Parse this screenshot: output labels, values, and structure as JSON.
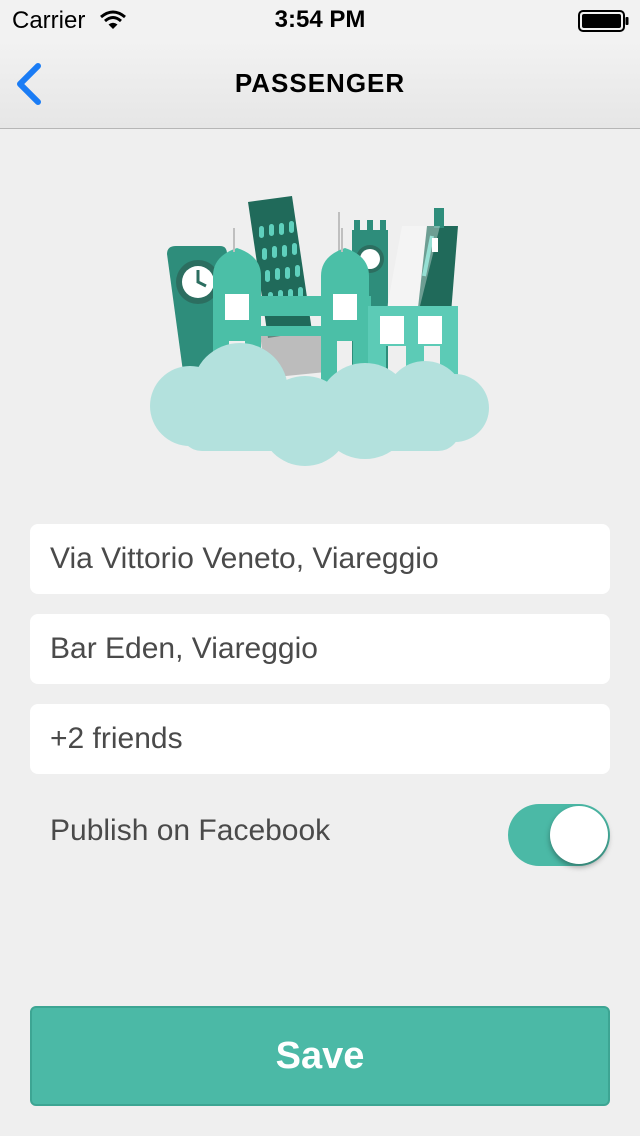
{
  "status_bar": {
    "carrier": "Carrier",
    "time": "3:54 PM"
  },
  "nav": {
    "back_icon": "chevron-left-icon",
    "title": "PASSENGER"
  },
  "illustration": {
    "name": "city-skyline-illustration"
  },
  "form": {
    "from_value": "Via Vittorio Veneto, Viareggio",
    "to_value": "Bar Eden, Viareggio",
    "friends_value": "+2 friends",
    "facebook_label": "Publish on Facebook",
    "facebook_enabled": true
  },
  "save_label": "Save",
  "colors": {
    "accent": "#4bb9a6",
    "ios_blue": "#1a7cf5",
    "background": "#efefef"
  }
}
